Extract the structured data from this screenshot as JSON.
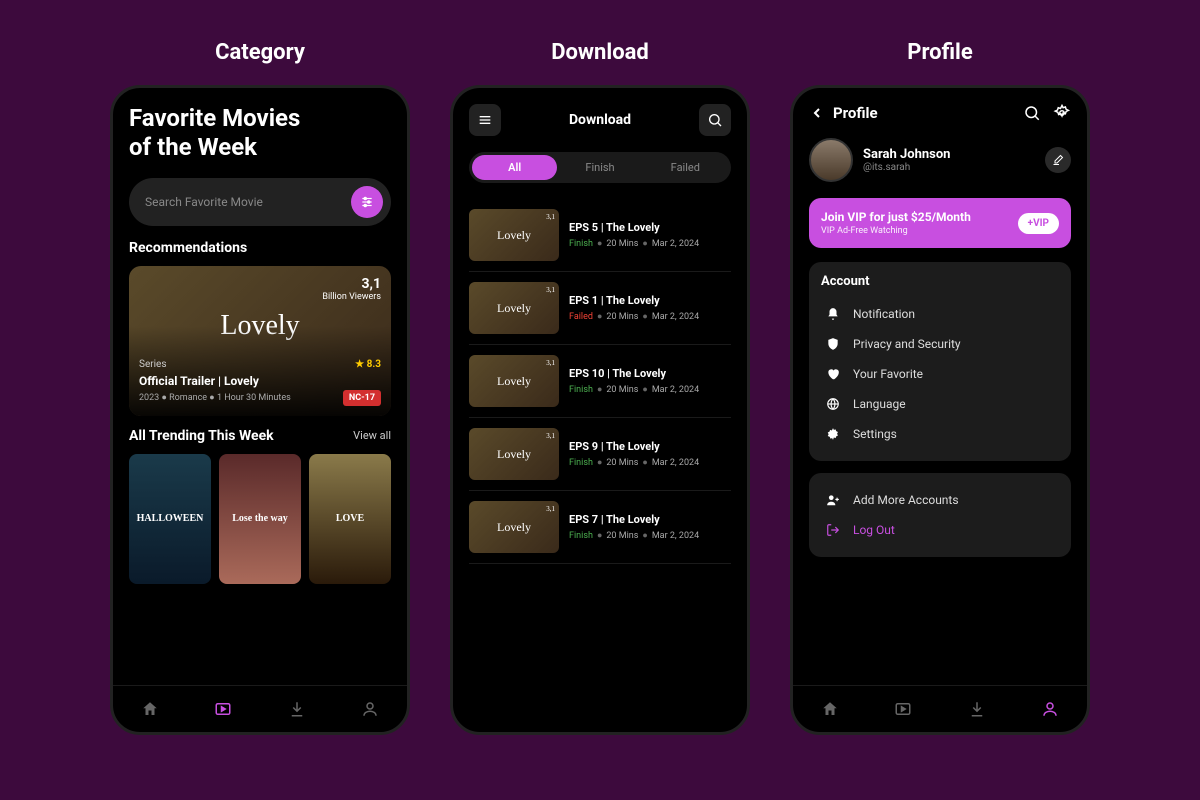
{
  "labels": {
    "category": "Category",
    "download": "Download",
    "profile": "Profile"
  },
  "screen1": {
    "title1": "Favorite Movies",
    "title2": "of the Week",
    "search_placeholder": "Search Favorite Movie",
    "recommendations_heading": "Recommendations",
    "reco": {
      "movie_name": "Lovely",
      "viewers_num": "3,1",
      "viewers_unit": "Billion Viewers",
      "series_label": "Series",
      "rating": "★ 8.3",
      "subtitle": "Official Trailer | Lovely",
      "info": "2023  ●  Romance  ●  1 Hour 30 Minutes",
      "badge": "NC-17"
    },
    "trending_heading": "All Trending This Week",
    "view_all": "View all",
    "posters": [
      "HALLOWEEN",
      "Lose the way",
      "LOVE"
    ]
  },
  "screen2": {
    "title": "Download",
    "tabs": [
      "All",
      "Finish",
      "Failed"
    ],
    "thumb_name": "Lovely",
    "items": [
      {
        "ep": "EPS 5 |  The Lovely",
        "status": "Finish",
        "duration": "20 Mins",
        "date": "Mar 2, 2024"
      },
      {
        "ep": "EPS 1 | The Lovely",
        "status": "Failed",
        "duration": "20 Mins",
        "date": "Mar 2, 2024"
      },
      {
        "ep": "EPS 10 | The Lovely",
        "status": "Finish",
        "duration": "20 Mins",
        "date": "Mar 2, 2024"
      },
      {
        "ep": "EPS 9 | The Lovely",
        "status": "Finish",
        "duration": "20 Mins",
        "date": "Mar 2, 2024"
      },
      {
        "ep": "EPS 7 | The Lovely",
        "status": "Finish",
        "duration": "20 Mins",
        "date": "Mar 2, 2024"
      }
    ]
  },
  "screen3": {
    "title": "Profile",
    "user_name": "Sarah Johnson",
    "user_handle": "@its.sarah",
    "vip_title": "Join VIP for just $25/Month",
    "vip_sub": "VIP Ad-Free Watching",
    "vip_btn": "+VIP",
    "account_heading": "Account",
    "menu1": [
      "Notification",
      "Privacy and Security",
      "Your Favorite",
      "Language",
      "Settings"
    ],
    "menu2_add": "Add More Accounts",
    "menu2_logout": "Log Out"
  }
}
